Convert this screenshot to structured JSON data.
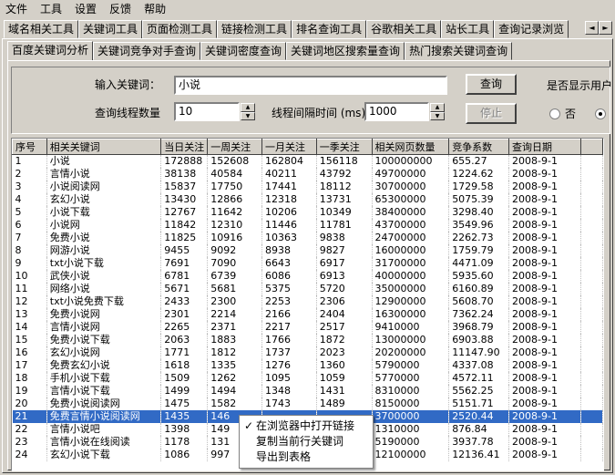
{
  "menu": [
    "文件",
    "工具",
    "设置",
    "反馈",
    "帮助"
  ],
  "top_tabs": [
    {
      "label": "域名相关工具",
      "active": false
    },
    {
      "label": "关键词工具",
      "active": true
    },
    {
      "label": "页面检测工具",
      "active": false
    },
    {
      "label": "链接检测工具",
      "active": false
    },
    {
      "label": "排名查询工具",
      "active": false
    },
    {
      "label": "谷歌相关工具",
      "active": false
    },
    {
      "label": "站长工具",
      "active": false
    },
    {
      "label": "查询记录浏览",
      "active": false
    }
  ],
  "tab_scroll": {
    "left": "◄",
    "right": "►"
  },
  "sub_tabs": [
    {
      "label": "百度关键词分析",
      "active": true
    },
    {
      "label": "关键词竞争对手查询",
      "active": false
    },
    {
      "label": "关键词密度查询",
      "active": false
    },
    {
      "label": "关键词地区搜索量查询",
      "active": false
    },
    {
      "label": "热门搜索关键词查询",
      "active": false
    }
  ],
  "form": {
    "keyword_label": "输入关键词：",
    "keyword_value": "小说",
    "query_button": "查询",
    "show_label": "是否显示用户",
    "threads_label": "查询线程数量",
    "threads_value": "10",
    "interval_label": "线程间隔时间 (ms)",
    "interval_value": "1000",
    "stop_button": "停止",
    "radio_no": "否"
  },
  "table": {
    "columns": [
      "序号",
      "相关关键词",
      "当日关注",
      "一周关注",
      "一月关注",
      "一季关注",
      "相关网页数量",
      "竞争系数",
      "查询日期"
    ],
    "rows": [
      [
        "1",
        "小说",
        "172888",
        "152608",
        "162804",
        "156118",
        "100000000",
        "655.27",
        "2008-9-1"
      ],
      [
        "2",
        "言情小说",
        "38138",
        "40584",
        "40211",
        "43792",
        "49700000",
        "1224.62",
        "2008-9-1"
      ],
      [
        "3",
        "小说阅读网",
        "15837",
        "17750",
        "17441",
        "18112",
        "30700000",
        "1729.58",
        "2008-9-1"
      ],
      [
        "4",
        "玄幻小说",
        "13430",
        "12866",
        "12318",
        "13731",
        "65300000",
        "5075.39",
        "2008-9-1"
      ],
      [
        "5",
        "小说下载",
        "12767",
        "11642",
        "10206",
        "10349",
        "38400000",
        "3298.40",
        "2008-9-1"
      ],
      [
        "6",
        "小说网",
        "11842",
        "12310",
        "11446",
        "11781",
        "43700000",
        "3549.96",
        "2008-9-1"
      ],
      [
        "7",
        "免费小说",
        "11825",
        "10916",
        "10363",
        "9838",
        "24700000",
        "2262.73",
        "2008-9-1"
      ],
      [
        "8",
        "网游小说",
        "9455",
        "9092",
        "8938",
        "9827",
        "16000000",
        "1759.79",
        "2008-9-1"
      ],
      [
        "9",
        "txt小说下载",
        "7691",
        "7090",
        "6643",
        "6917",
        "31700000",
        "4471.09",
        "2008-9-1"
      ],
      [
        "10",
        "武侠小说",
        "6781",
        "6739",
        "6086",
        "6913",
        "40000000",
        "5935.60",
        "2008-9-1"
      ],
      [
        "11",
        "网络小说",
        "5671",
        "5681",
        "5375",
        "5720",
        "35000000",
        "6160.89",
        "2008-9-1"
      ],
      [
        "12",
        "txt小说免费下载",
        "2433",
        "2300",
        "2253",
        "2306",
        "12900000",
        "5608.70",
        "2008-9-1"
      ],
      [
        "13",
        "免费小说网",
        "2301",
        "2214",
        "2166",
        "2404",
        "16300000",
        "7362.24",
        "2008-9-1"
      ],
      [
        "14",
        "言情小说网",
        "2265",
        "2371",
        "2217",
        "2517",
        "9410000",
        "3968.79",
        "2008-9-1"
      ],
      [
        "15",
        "免费小说下载",
        "2063",
        "1883",
        "1766",
        "1872",
        "13000000",
        "6903.88",
        "2008-9-1"
      ],
      [
        "16",
        "玄幻小说网",
        "1771",
        "1812",
        "1737",
        "2023",
        "20200000",
        "11147.90",
        "2008-9-1"
      ],
      [
        "17",
        "免费玄幻小说",
        "1618",
        "1335",
        "1276",
        "1360",
        "5790000",
        "4337.08",
        "2008-9-1"
      ],
      [
        "18",
        "手机小说下载",
        "1509",
        "1262",
        "1095",
        "1059",
        "5770000",
        "4572.11",
        "2008-9-1"
      ],
      [
        "19",
        "言情小说下载",
        "1499",
        "1494",
        "1348",
        "1431",
        "8310000",
        "5562.25",
        "2008-9-1"
      ],
      [
        "20",
        "免费小说阅读网",
        "1475",
        "1582",
        "1743",
        "1489",
        "8150000",
        "5151.71",
        "2008-9-1"
      ],
      [
        "21",
        "免费言情小说阅读网",
        "1435",
        "146",
        "",
        "",
        "3700000",
        "2520.44",
        "2008-9-1"
      ],
      [
        "22",
        "言情小说吧",
        "1398",
        "149",
        "",
        "",
        "1310000",
        "876.84",
        "2008-9-1"
      ],
      [
        "23",
        "言情小说在线阅读",
        "1178",
        "131",
        "",
        "",
        "5190000",
        "3937.78",
        "2008-9-1"
      ],
      [
        "24",
        "玄幻小说下载",
        "1086",
        "997",
        "",
        "",
        "12100000",
        "12136.41",
        "2008-9-1"
      ]
    ],
    "selected_row": 20
  },
  "context_menu": [
    {
      "label": "在浏览器中打开链接",
      "checked": true
    },
    {
      "label": "复制当前行关键词",
      "checked": false
    },
    {
      "label": "导出到表格",
      "checked": false
    }
  ]
}
